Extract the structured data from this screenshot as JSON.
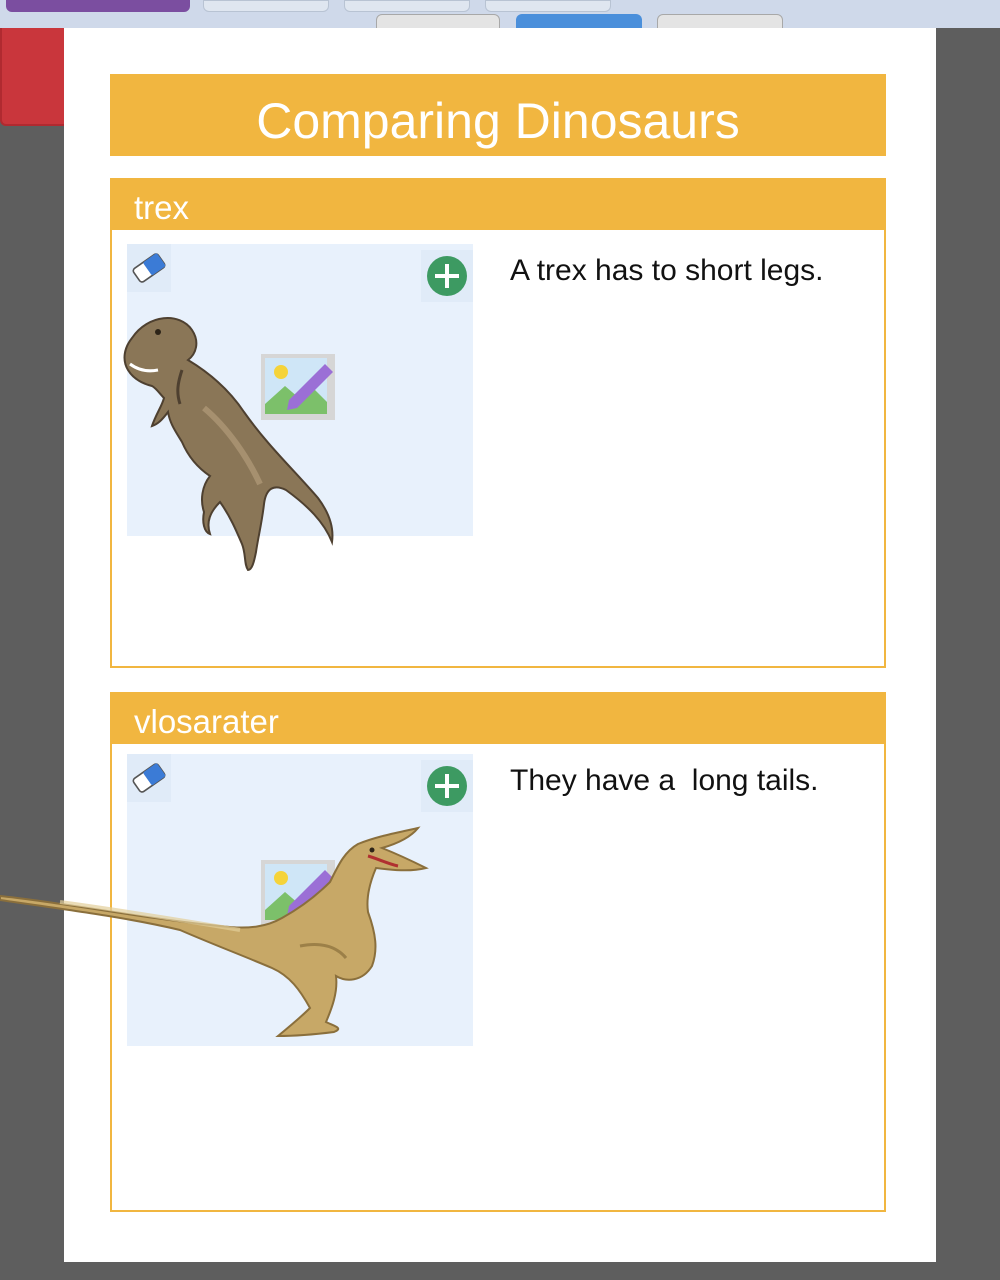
{
  "title": "Comparing Dinosaurs",
  "cards": [
    {
      "heading": "trex",
      "text": "A trex has to short legs.",
      "image_icon": "t-rex-illustration"
    },
    {
      "heading": "vlosarater",
      "text": "They have a  long tails.",
      "image_icon": "velociraptor-illustration"
    }
  ],
  "colors": {
    "accent": "#f1b640",
    "image_bg": "#e8f1fc",
    "add_green": "#3d9a62",
    "toolbar_red": "#c9363c",
    "toolbar_blue": "#4a8fdb",
    "toolbar_purple": "#7b4ea0"
  }
}
